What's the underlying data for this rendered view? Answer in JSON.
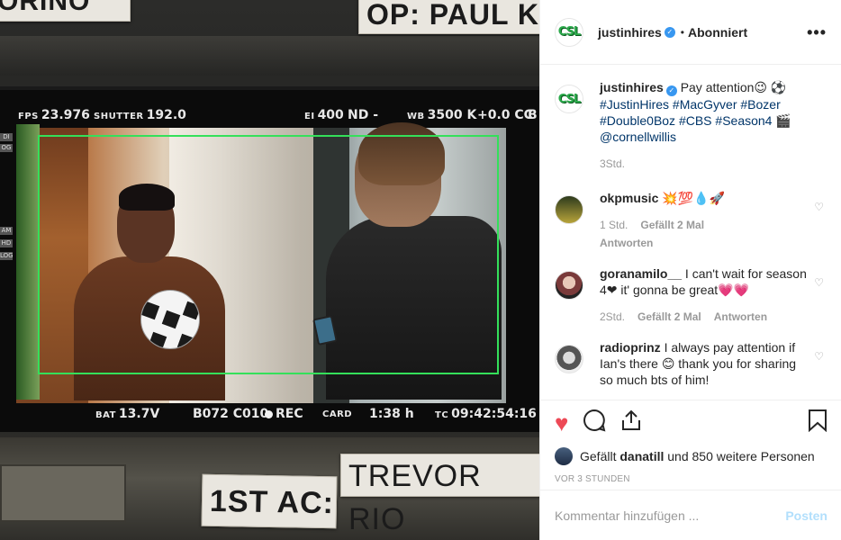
{
  "photo": {
    "tape_top_left": "ORINO",
    "tape_top_right": "OP: PAUL K",
    "tape_bottom_left": "1ST AC:",
    "tape_bottom_right": "TREVOR RIO",
    "hud": {
      "fps_label": "FPS",
      "fps": "23.976",
      "shutter_label": "SHUTTER",
      "shutter": "192.0",
      "ei_label": "EI",
      "ei": "400",
      "nd": "ND -",
      "wb_label": "WB",
      "wb": "3500 K",
      "cc": "+0.0 CC",
      "b": "B",
      "bat_label": "BAT",
      "bat": "13.7V",
      "clip": "B072 C010",
      "rec": "REC",
      "card": "CARD",
      "remaining": "1:38 h",
      "tc_label": "TC",
      "tc": "09:42:54:16",
      "side_di": "DI",
      "side_og": "OG",
      "side_am": "AM",
      "side_hd": "HD",
      "side_log": "LOG"
    }
  },
  "post": {
    "author": {
      "avatar_text": "CSL",
      "username": "justinhires",
      "separator": "•",
      "follow_state": "Abonniert"
    },
    "more_label": "•••",
    "caption": {
      "username": "justinhires",
      "text": "Pay attention😉 ⚽",
      "tags": "#JustinHires #MacGyver #Bozer #Double0Boz #CBS #Season4 🎬 @cornellwillis",
      "time": "3Std."
    },
    "comments": [
      {
        "username": "okpmusic",
        "text": "💥💯💧🚀",
        "time": "1 Std.",
        "likes": "Gefällt 2 Mal",
        "reply": "Antworten"
      },
      {
        "username": "goranamilo__",
        "text": "I can't wait for season 4❤ it' gonna be great💗💗",
        "time": "2Std.",
        "likes": "Gefällt 2 Mal",
        "reply": "Antworten"
      },
      {
        "username": "radioprinz",
        "text": "I always pay attention if Ian's there 😊 thank you for sharing so much bts of him!",
        "time": "",
        "likes": "",
        "reply": ""
      }
    ],
    "actions": {
      "like_icon": "heart-icon",
      "comment_icon": "comment-icon",
      "share_icon": "share-icon",
      "save_icon": "bookmark-icon"
    },
    "likes": {
      "prefix": "Gefällt",
      "user": "danatill",
      "suffix": "und 850 weitere Personen"
    },
    "timeago": "VOR 3 STUNDEN",
    "add_comment": {
      "placeholder": "Kommentar hinzufügen ...",
      "post_label": "Posten"
    },
    "colors": {
      "liked": "#ed4956",
      "link": "#003569",
      "post_disabled": "#b2dffc",
      "verified": "#3897f0"
    }
  }
}
